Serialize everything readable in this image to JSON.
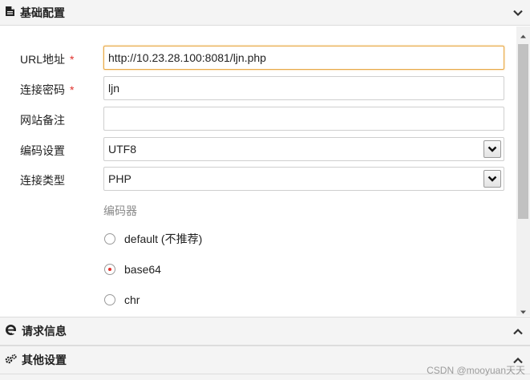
{
  "sections": {
    "basic": {
      "title": "基础配置",
      "icon": "document-icon",
      "state": "expanded"
    },
    "request": {
      "title": "请求信息",
      "icon": "ie-icon",
      "state": "collapsed"
    },
    "other": {
      "title": "其他设置",
      "icon": "gears-icon",
      "state": "collapsed"
    }
  },
  "form": {
    "url": {
      "label": "URL地址",
      "required_mark": "*",
      "value": "http://10.23.28.100:8081/ljn.php"
    },
    "password": {
      "label": "连接密码",
      "required_mark": "*",
      "value": "ljn"
    },
    "note": {
      "label": "网站备注",
      "value": ""
    },
    "encoding": {
      "label": "编码设置",
      "value": "UTF8"
    },
    "type": {
      "label": "连接类型",
      "value": "PHP"
    },
    "encoder": {
      "label": "编码器",
      "options": [
        {
          "label": "default (不推荐)",
          "checked": false
        },
        {
          "label": "base64",
          "checked": true
        },
        {
          "label": "chr",
          "checked": false
        }
      ]
    }
  },
  "watermark": "CSDN @mooyuan天天",
  "colors": {
    "required": "#e0322d",
    "focus_border": "#e8a844",
    "header_bg": "#f4f4f4"
  }
}
